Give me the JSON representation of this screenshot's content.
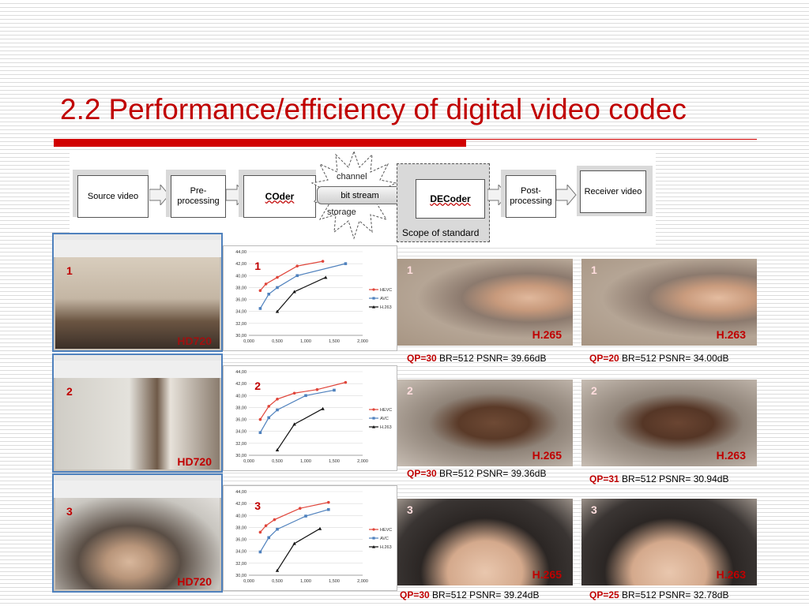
{
  "slide": {
    "title_number": "2.2",
    "title_text": "Performance/efficiency of digital video codec"
  },
  "pipeline": {
    "source": "Source video",
    "pre_line1": "Pre-",
    "pre_line2": "processing",
    "coder": "COder",
    "channel": "channel",
    "bitstream": "bit stream",
    "storage": "storage",
    "decoder": "DECoder",
    "scope": "Scope of standard",
    "post_line1": "Post-",
    "post_line2": "processing",
    "receiver": "Receiver video"
  },
  "rows": [
    {
      "index": "1",
      "hd": "HD720",
      "left": {
        "index": "1",
        "codec": "H.265",
        "qp": "QP=30",
        "info": " BR=512 PSNR= 39.66dB"
      },
      "right": {
        "index": "1",
        "codec": "H.263",
        "qp": "QP=20",
        "info": " BR=512 PSNR= 34.00dB"
      }
    },
    {
      "index": "2",
      "hd": "HD720",
      "left": {
        "index": "2",
        "codec": "H.265",
        "qp": "QP=30",
        "info": " BR=512 PSNR= 39.36dB"
      },
      "right": {
        "index": "2",
        "codec": "H.263",
        "qp": "QP=31",
        "info": " BR=512 PSNR= 30.94dB"
      }
    },
    {
      "index": "3",
      "hd": "HD720",
      "left": {
        "index": "3",
        "codec": "H.265",
        "qp": "QP=30",
        "info": " BR=512 PSNR= 39.24dB"
      },
      "right": {
        "index": "3",
        "codec": "H.263",
        "qp": "QP=25",
        "info": " BR=512 PSNR= 32.78dB"
      }
    }
  ],
  "chart_data": [
    {
      "type": "line",
      "title": "1",
      "yticks": [
        "44,00",
        "42,00",
        "40,00",
        "38,00",
        "36,00",
        "34,00",
        "32,00",
        "30,00"
      ],
      "xticks": [
        "0,000",
        "0,500",
        "1,000",
        "1,500",
        "2,000"
      ],
      "xlim": [
        0,
        2.0
      ],
      "ylim": [
        30,
        44
      ],
      "legend_position": "right",
      "series": [
        {
          "name": "HEVC",
          "color": "#e0453a",
          "marker": "circle",
          "x": [
            0.2,
            0.3,
            0.5,
            0.85,
            1.3
          ],
          "y": [
            37.5,
            38.6,
            39.7,
            41.6,
            42.4
          ]
        },
        {
          "name": "AVC",
          "color": "#4f81bd",
          "marker": "square",
          "x": [
            0.2,
            0.35,
            0.5,
            0.85,
            1.7
          ],
          "y": [
            34.5,
            36.9,
            38.0,
            40.0,
            42.0
          ]
        },
        {
          "name": "H.263",
          "color": "#111111",
          "marker": "triangle",
          "x": [
            0.5,
            0.8,
            1.35
          ],
          "y": [
            34.0,
            37.3,
            39.7
          ]
        }
      ]
    },
    {
      "type": "line",
      "title": "2",
      "yticks": [
        "44,00",
        "42,00",
        "40,00",
        "38,00",
        "36,00",
        "34,00",
        "32,00",
        "30,00"
      ],
      "xticks": [
        "0,000",
        "0,500",
        "1,000",
        "1,500",
        "2,000"
      ],
      "xlim": [
        0,
        2.0
      ],
      "ylim": [
        30,
        44
      ],
      "legend_position": "right",
      "series": [
        {
          "name": "HEVC",
          "color": "#e0453a",
          "marker": "circle",
          "x": [
            0.2,
            0.35,
            0.5,
            0.8,
            1.2,
            1.7
          ],
          "y": [
            36.0,
            38.2,
            39.4,
            40.4,
            41.0,
            42.2
          ]
        },
        {
          "name": "AVC",
          "color": "#4f81bd",
          "marker": "square",
          "x": [
            0.2,
            0.35,
            0.5,
            1.0,
            1.5
          ],
          "y": [
            33.8,
            36.3,
            37.6,
            40.0,
            40.9
          ]
        },
        {
          "name": "H.263",
          "color": "#111111",
          "marker": "triangle",
          "x": [
            0.5,
            0.8,
            1.3
          ],
          "y": [
            30.9,
            35.2,
            37.8
          ]
        }
      ]
    },
    {
      "type": "line",
      "title": "3",
      "yticks": [
        "44,00",
        "42,00",
        "40,00",
        "38,00",
        "36,00",
        "34,00",
        "32,00",
        "30,00"
      ],
      "xticks": [
        "0,000",
        "0,500",
        "1,000",
        "1,500",
        "2,000"
      ],
      "xlim": [
        0,
        2.0
      ],
      "ylim": [
        30,
        44
      ],
      "legend_position": "right",
      "series": [
        {
          "name": "HEVC",
          "color": "#e0453a",
          "marker": "circle",
          "x": [
            0.2,
            0.3,
            0.45,
            0.9,
            1.4
          ],
          "y": [
            37.2,
            38.3,
            39.3,
            41.2,
            42.2
          ]
        },
        {
          "name": "AVC",
          "color": "#4f81bd",
          "marker": "square",
          "x": [
            0.2,
            0.35,
            0.5,
            1.0,
            1.4
          ],
          "y": [
            33.9,
            36.3,
            37.7,
            39.9,
            41.0
          ]
        },
        {
          "name": "H.263",
          "color": "#111111",
          "marker": "triangle",
          "x": [
            0.5,
            0.8,
            1.25
          ],
          "y": [
            30.8,
            35.3,
            37.8
          ]
        }
      ]
    }
  ]
}
